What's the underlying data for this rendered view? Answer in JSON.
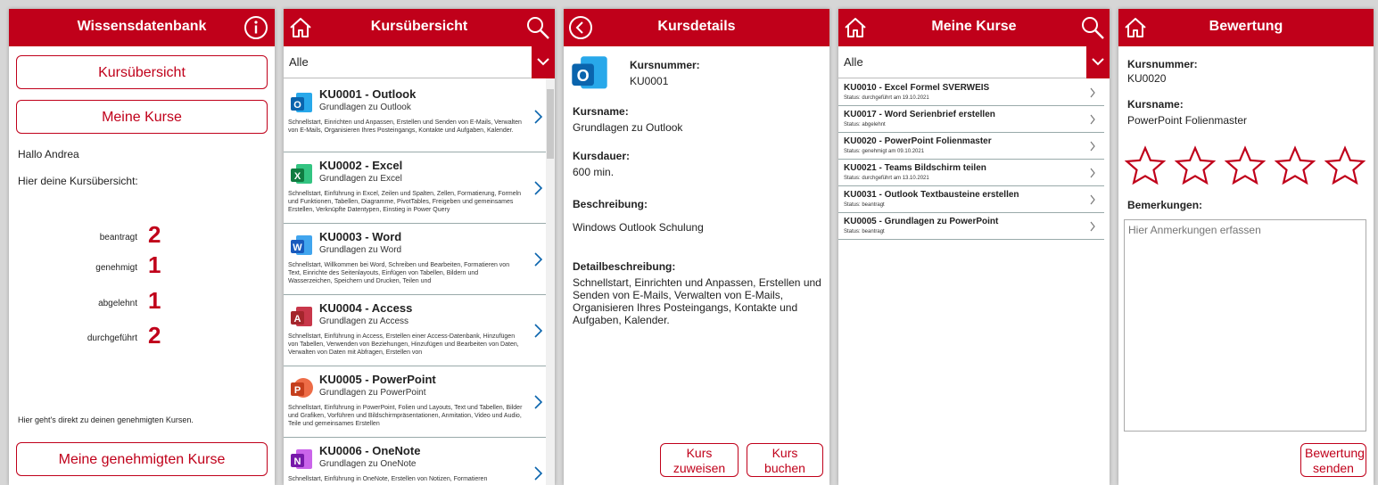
{
  "colors": {
    "accent": "#c0001a"
  },
  "p1": {
    "title": "Wissensdatenbank",
    "info_icon": "info-icon",
    "btn_uebersicht": "Kursübersicht",
    "btn_meine": "Meine Kurse",
    "hello": "Hallo Andrea",
    "overview": "Hier deine Kursübersicht:",
    "stats": [
      {
        "label": "beantragt",
        "value": "2"
      },
      {
        "label": "genehmigt",
        "value": "1"
      },
      {
        "label": "abgelehnt",
        "value": "1"
      },
      {
        "label": "durchgeführt",
        "value": "2"
      }
    ],
    "footer_text": "Hier geht's direkt zu deinen genehmigten Kursen.",
    "btn_genehmigt": "Meine genehmigten Kurse"
  },
  "p2": {
    "title": "Kursübersicht",
    "filter": "Alle",
    "courses": [
      {
        "icon": "outlook-icon",
        "title": "KU0001 - Outlook",
        "sub": "Grundlagen zu Outlook",
        "desc": "Schnellstart, Einrichten und Anpassen, Erstellen und Senden von E-Mails, Verwalten von E-Mails, Organisieren Ihres Posteingangs, Kontakte und Aufgaben, Kalender."
      },
      {
        "icon": "excel-icon",
        "title": "KU0002 - Excel",
        "sub": "Grundlagen zu Excel",
        "desc": "Schnellstart, Einführung in Excel, Zeilen und Spalten, Zellen, Formatierung, Formeln und Funktionen, Tabellen, Diagramme, PivotTables, Freigeben und gemeinsames Erstellen, Verknüpfte Datentypen, Einstieg in Power Query"
      },
      {
        "icon": "word-icon",
        "title": "KU0003 - Word",
        "sub": "Grundlagen zu Word",
        "desc": "Schnellstart, Willkommen bei Word, Schreiben und Bearbeiten, Formatieren von Text, Einrichte des Seitenlayouts, Einfügen von Tabellen, Bildern und Wasserzeichen, Speichern und Drucken, Teilen und"
      },
      {
        "icon": "access-icon",
        "title": "KU0004 - Access",
        "sub": "Grundlagen zu Access",
        "desc": "Schnellstart, Einführung in Access, Erstellen einer Access-Datenbank, Hinzufügen von Tabellen, Verwenden von Beziehungen, Hinzufügen und Bearbeiten von Daten, Verwalten von Daten mit Abfragen, Erstellen von"
      },
      {
        "icon": "powerpoint-icon",
        "title": "KU0005 - PowerPoint",
        "sub": "Grundlagen zu PowerPoint",
        "desc": "Schnellstart, Einführung in PowerPoint, Folien und Layouts, Text und Tabellen, Bilder und Grafiken, Vorführen und Bildschirmpräsentationen, Anmitation, Video und Audio, Teile und gemeinsames Erstellen"
      },
      {
        "icon": "onenote-icon",
        "title": "KU0006 - OneNote",
        "sub": "Grundlagen zu OneNote",
        "desc": "Schnellstart, Einführung in OneNote, Erstellen von Notizen, Formatieren"
      }
    ]
  },
  "p3": {
    "title": "Kursdetails",
    "nr_label": "Kursnummer:",
    "nr_value": "KU0001",
    "name_label": "Kursname:",
    "name_value": "Grundlagen zu Outlook",
    "dauer_label": "Kursdauer:",
    "dauer_value": "600 min.",
    "beschr_label": "Beschreibung:",
    "beschr_value": "Windows Outlook Schulung",
    "detail_label": "Detailbeschreibung:",
    "detail_value": "Schnellstart, Einrichten und Anpassen, Erstellen und Senden von E-Mails, Verwalten von E-Mails, Organisieren Ihres Posteingangs, Kontakte und Aufgaben, Kalender.",
    "btn_zuweisen": "Kurs zuweisen",
    "btn_buchen": "Kurs buchen"
  },
  "p4": {
    "title": "Meine Kurse",
    "filter": "Alle",
    "rows": [
      {
        "title": "KU0010 - Excel Formel SVERWEIS",
        "status": "Status: durchgeführt am 19.10.2021"
      },
      {
        "title": "KU0017 - Word Serienbrief erstellen",
        "status": "Status: abgelehnt"
      },
      {
        "title": "KU0020 - PowerPoint Folienmaster",
        "status": "Status: genehmigt am 09.10.2021"
      },
      {
        "title": "KU0021 - Teams Bildschirm teilen",
        "status": "Status: durchgeführt am 13.10.2021"
      },
      {
        "title": "KU0031 - Outlook Textbausteine erstellen",
        "status": "Status: beantragt"
      },
      {
        "title": "KU0005 - Grundlagen zu PowerPoint",
        "status": "Status: beantragt"
      }
    ]
  },
  "p5": {
    "title": "Bewertung",
    "nr_label": "Kursnummer:",
    "nr_value": "KU0020",
    "name_label": "Kursname:",
    "name_value": "PowerPoint Folienmaster",
    "rating": 0,
    "rating_max": 5,
    "remarks_label": "Bemerkungen:",
    "remarks_placeholder": "Hier Anmerkungen erfassen",
    "btn_senden": "Bewertung senden"
  }
}
